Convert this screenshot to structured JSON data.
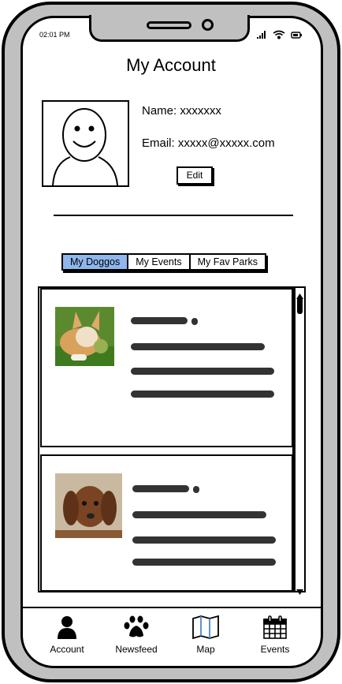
{
  "status_bar": {
    "time": "02:01 PM",
    "icons": [
      "signal-icon",
      "wifi-icon",
      "battery-icon"
    ]
  },
  "header": {
    "title": "My Account"
  },
  "profile": {
    "name_label": "Name: xxxxxxx",
    "email_label": "Email: xxxxx@xxxxx.com",
    "edit_label": "Edit",
    "avatar_icon": "smiley-person-icon"
  },
  "tabs": [
    {
      "label": "My Doggos",
      "active": true
    },
    {
      "label": "My Events",
      "active": false
    },
    {
      "label": "My Fav Parks",
      "active": false
    }
  ],
  "colors": {
    "active_tab": "#8fb7ee",
    "frame": "#c0c0c0"
  },
  "doggos": [
    {
      "image": "corgi-puppy-photo"
    },
    {
      "image": "dachshund-puppy-photo"
    }
  ],
  "bottom_nav": [
    {
      "label": "Account",
      "icon": "person-icon"
    },
    {
      "label": "Newsfeed",
      "icon": "paw-icon"
    },
    {
      "label": "Map",
      "icon": "map-icon"
    },
    {
      "label": "Events",
      "icon": "calendar-icon"
    }
  ]
}
